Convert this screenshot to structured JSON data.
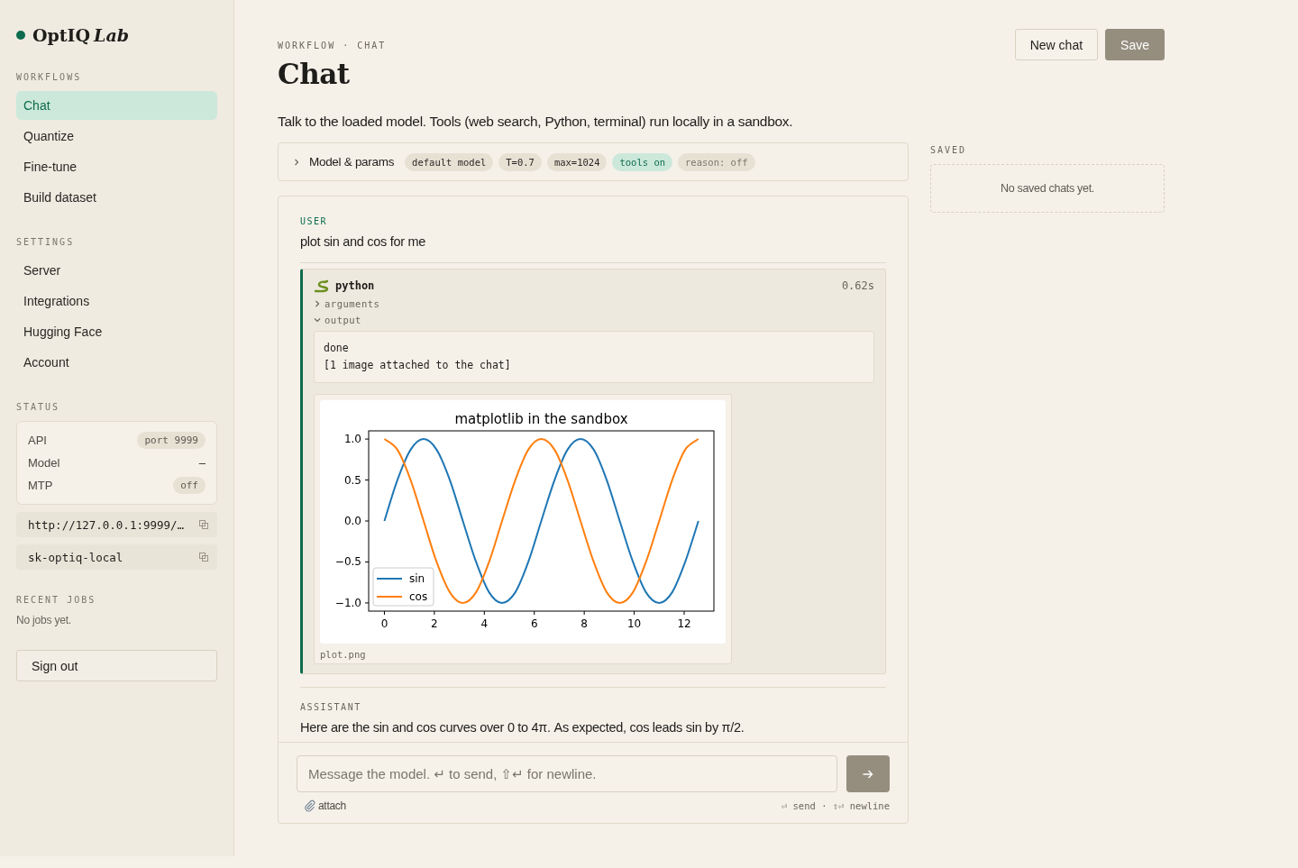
{
  "brand": {
    "name": "OptIQ",
    "suffix": "Lab"
  },
  "sidebar": {
    "sections": [
      {
        "title": "WORKFLOWS",
        "items": [
          {
            "label": "Chat",
            "selected": true
          },
          {
            "label": "Quantize",
            "selected": false
          },
          {
            "label": "Fine-tune",
            "selected": false
          },
          {
            "label": "Build dataset",
            "selected": false
          }
        ]
      },
      {
        "title": "SETTINGS",
        "items": [
          {
            "label": "Server",
            "selected": false
          },
          {
            "label": "Integrations",
            "selected": false
          },
          {
            "label": "Hugging Face",
            "selected": false
          },
          {
            "label": "Account",
            "selected": false
          }
        ]
      }
    ],
    "status": {
      "title": "STATUS",
      "rows": [
        {
          "label": "API",
          "value": "port 9999",
          "kind": "pill"
        },
        {
          "label": "Model",
          "value": "–",
          "kind": "plain"
        },
        {
          "label": "MTP",
          "value": "off",
          "kind": "pill"
        }
      ],
      "copy_fields": [
        "http://127.0.0.1:9999/…",
        "sk-optiq-local"
      ]
    },
    "recent_jobs": {
      "title": "RECENT JOBS",
      "empty": "No jobs yet."
    },
    "sign_out": "Sign out"
  },
  "header": {
    "breadcrumb": "WORKFLOW · CHAT",
    "title": "Chat",
    "buttons": [
      {
        "label": "New chat",
        "kind": "secondary"
      },
      {
        "label": "Save",
        "kind": "primary"
      }
    ]
  },
  "description": "Talk to the loaded model. Tools (web search, Python, terminal) run locally in a sandbox.",
  "params": {
    "label": "Model & params",
    "expanded": false,
    "chips": [
      {
        "text": "default model",
        "kind": "default"
      },
      {
        "text": "T=0.7",
        "kind": "default"
      },
      {
        "text": "max=1024",
        "kind": "default"
      },
      {
        "text": "tools on",
        "kind": "on"
      },
      {
        "text": "reason: off",
        "kind": "muted"
      }
    ]
  },
  "messages": [
    {
      "role": "USER",
      "text": "plot sin and cos for me"
    },
    {
      "role": "ASSISTANT",
      "text": "Here are the sin and cos curves over 0 to 4π. As expected, cos leads sin by π/2."
    }
  ],
  "tool_call": {
    "name": "python",
    "time": "0.62s",
    "sections": [
      {
        "label": "arguments",
        "expanded": false
      },
      {
        "label": "output",
        "expanded": true
      }
    ],
    "output_lines": [
      "done",
      "[1 image attached to the chat]"
    ],
    "image_caption": "plot.png",
    "chart_data": {
      "type": "line",
      "title": "matplotlib in the sandbox",
      "x": [
        0,
        0.52,
        1.05,
        1.57,
        2.09,
        2.62,
        3.14,
        3.67,
        4.19,
        4.71,
        5.24,
        5.76,
        6.28,
        6.81,
        7.33,
        7.85,
        8.38,
        8.9,
        9.42,
        9.95,
        10.47,
        11,
        11.52,
        12.04,
        12.57
      ],
      "series": [
        {
          "name": "sin",
          "color": "#1f77b4",
          "values": [
            0,
            0.5,
            0.87,
            1,
            0.87,
            0.5,
            0,
            -0.5,
            -0.87,
            -1,
            -0.87,
            -0.5,
            0,
            0.5,
            0.87,
            1,
            0.87,
            0.5,
            0,
            -0.5,
            -0.87,
            -1,
            -0.87,
            -0.5,
            0
          ]
        },
        {
          "name": "cos",
          "color": "#ff7f0e",
          "values": [
            1,
            0.87,
            0.5,
            0,
            -0.5,
            -0.87,
            -1,
            -0.87,
            -0.5,
            0,
            0.5,
            0.87,
            1,
            0.87,
            0.5,
            0,
            -0.5,
            -0.87,
            -1,
            -0.87,
            -0.5,
            0,
            0.5,
            0.87,
            1
          ]
        }
      ],
      "legend": "lower left",
      "xlim": [
        -0.63,
        13.19
      ],
      "ylim": [
        -1.1,
        1.1
      ],
      "xticks": [
        0,
        2,
        4,
        6,
        8,
        10,
        12
      ],
      "yticks": [
        {
          "value": -1,
          "label": "−1.0"
        },
        {
          "value": -0.5,
          "label": "−0.5"
        },
        {
          "value": 0,
          "label": "0.0"
        },
        {
          "value": 0.5,
          "label": "0.5"
        },
        {
          "value": 1,
          "label": "1.0"
        }
      ]
    }
  },
  "composer": {
    "placeholder": "Message the model. ↵ to send, ⇧↵ for newline.",
    "attach": "attach",
    "hint": "⏎ send · ⇧⏎ newline"
  },
  "saved": {
    "title": "SAVED",
    "empty": "No saved chats yet."
  }
}
